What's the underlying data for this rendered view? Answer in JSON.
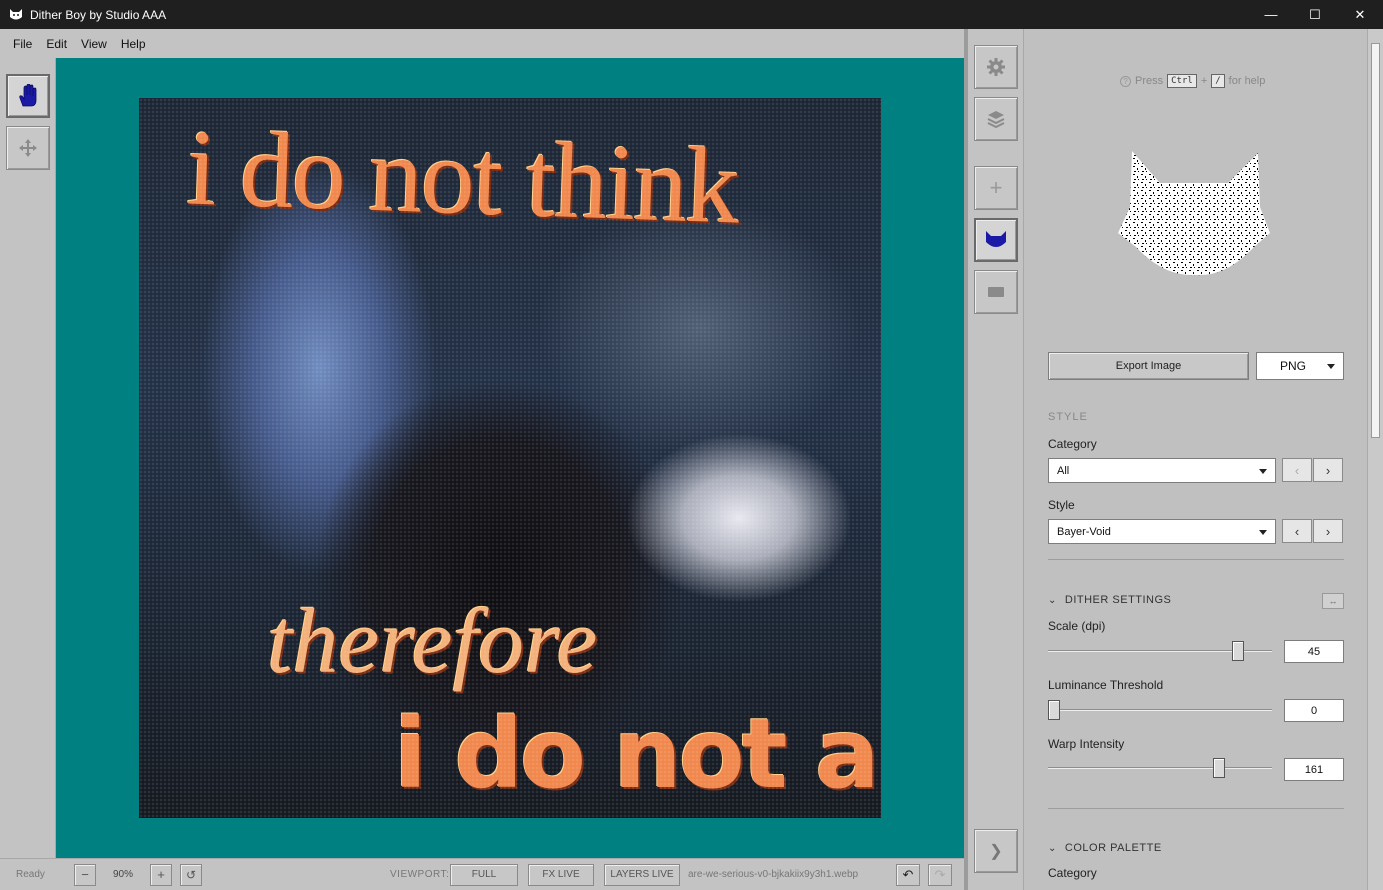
{
  "window": {
    "title": "Dither Boy by Studio AAA",
    "minimize": "—",
    "maximize": "☐",
    "close": "✕"
  },
  "menu": [
    "File",
    "Edit",
    "View",
    "Help"
  ],
  "canvas": {
    "line1": "i do not think",
    "line2": "therefore",
    "line3": "i do not ar"
  },
  "status": {
    "state": "Ready",
    "zoom_out": "−",
    "zoom": "90%",
    "zoom_in": "+",
    "reset": "↺",
    "viewport_label": "VIEWPORT:",
    "full": "FULL",
    "fx_live": "FX LIVE",
    "layers_live": "LAYERS LIVE",
    "filename": "are-we-serious-v0-bjkakiix9y3h1.webp",
    "undo": "↶",
    "redo": "↷"
  },
  "midbar": {
    "add": "+",
    "expand": "❯"
  },
  "panel": {
    "help_pre": "Press",
    "help_key1": "Ctrl",
    "help_plus": "+",
    "help_key2": "/",
    "help_post": "for help",
    "export_label": "Export Image",
    "format": "PNG",
    "style_section": "STYLE",
    "category_label": "Category",
    "category_value": "All",
    "style_label": "Style",
    "style_value": "Bayer-Void",
    "prev": "‹",
    "next": "›",
    "dither_section": "DITHER SETTINGS",
    "reset_icon": "↔",
    "scale_label": "Scale (dpi)",
    "scale_value": "45",
    "lum_label": "Luminance Threshold",
    "lum_value": "0",
    "warp_label": "Warp Intensity",
    "warp_value": "161",
    "palette_section": "COLOR PALETTE",
    "palette_category_label": "Category"
  },
  "sliders": {
    "scale_fraction": 0.87,
    "lum_fraction": 0.0,
    "warp_fraction": 0.78
  },
  "colors": {
    "canvas_bg": "#008080",
    "titlebar": "#1f1f1f",
    "accent_icon": "#1a1aa6"
  }
}
